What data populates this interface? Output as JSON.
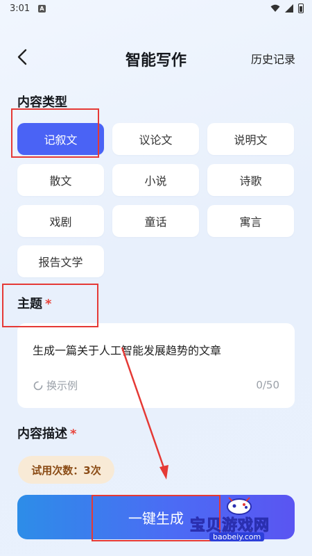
{
  "status_bar": {
    "time": "3:01",
    "notif": "A"
  },
  "header": {
    "title": "智能写作",
    "history": "历史记录"
  },
  "content_type": {
    "label": "内容类型",
    "options": [
      "记叙文",
      "议论文",
      "说明文",
      "散文",
      "小说",
      "诗歌",
      "戏剧",
      "童话",
      "寓言",
      "报告文学"
    ],
    "selected": "记叙文"
  },
  "topic": {
    "label": "主题",
    "required_mark": "*",
    "value": "生成一篇关于人工智能发展趋势的文章",
    "refresh_label": "换示例",
    "count": "0/50"
  },
  "description": {
    "label": "内容描述",
    "required_mark": "*"
  },
  "trial": {
    "text": "试用次数：3次"
  },
  "generate": {
    "label": "一键生成"
  },
  "watermark": {
    "text": "宝贝游戏网",
    "url": "baobeiy.com"
  },
  "colors": {
    "accent": "#4a63f5",
    "annotation": "#e53935",
    "trial_bg": "#f8ead6"
  }
}
